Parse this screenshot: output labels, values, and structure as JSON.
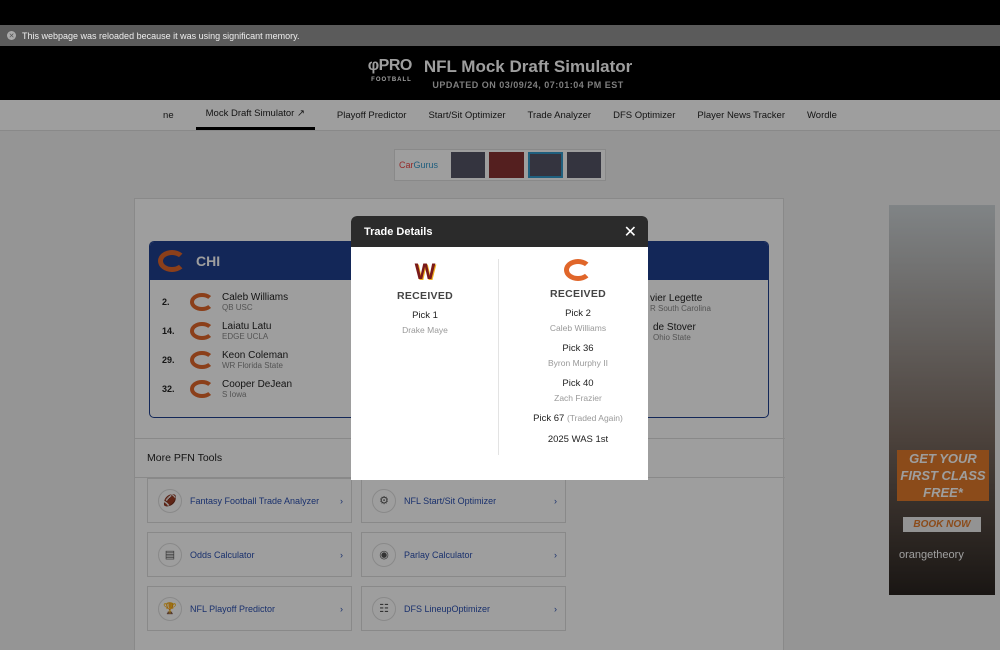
{
  "notice": "This webpage was reloaded because it was using significant memory.",
  "header": {
    "logo": "PRO",
    "logo_sub": "FOOTBALL",
    "title": "NFL Mock Draft Simulator",
    "updated": "UPDATED ON 03/09/24, 07:01:04 PM EST"
  },
  "nav": [
    "ne",
    "Mock Draft Simulator ↗",
    "Playoff Predictor",
    "Start/Sit Optimizer",
    "Trade Analyzer",
    "DFS Optimizer",
    "Player News Tracker",
    "Wordle"
  ],
  "ad_top": {
    "brand": "Car",
    "brand2": "Gurus"
  },
  "team": {
    "abbr": "CHI",
    "picks": [
      {
        "num": "2.",
        "name": "Caleb Williams",
        "pos": "QB USC"
      },
      {
        "num": "14.",
        "name": "Laiatu Latu",
        "pos": "EDGE UCLA"
      },
      {
        "num": "29.",
        "name": "Keon Coleman",
        "pos": "WR Florida State"
      },
      {
        "num": "32.",
        "name": "Cooper DeJean",
        "pos": "S Iowa"
      }
    ],
    "right_picks": [
      {
        "name": "vier Legette",
        "pos": "R South Carolina"
      },
      {
        "name": "de Stover",
        "pos": "Ohio State"
      }
    ]
  },
  "tools": {
    "title": "More PFN Tools",
    "items": [
      {
        "label": "Fantasy Football Trade Analyzer",
        "icon": "football-icon"
      },
      {
        "label": "NFL Start/Sit Optimizer",
        "icon": "gear-icon"
      },
      {
        "label": "Odds Calculator",
        "icon": "calculator-icon"
      },
      {
        "label": "Parlay Calculator",
        "icon": "chip-icon"
      },
      {
        "label": "NFL Playoff Predictor",
        "icon": "trophy-icon"
      },
      {
        "label": "DFS LineupOptimizer",
        "icon": "team-icon"
      }
    ]
  },
  "side_ad": {
    "cta": "GET YOUR FIRST CLASS FREE*",
    "button": "BOOK NOW",
    "brand": "orangetheory"
  },
  "modal": {
    "title": "Trade Details",
    "left": {
      "team": "WAS",
      "received": "RECEIVED",
      "items": [
        {
          "pick": "Pick 1",
          "player": "Drake Maye"
        }
      ]
    },
    "right": {
      "team": "CHI",
      "received": "RECEIVED",
      "items": [
        {
          "pick": "Pick 2",
          "player": "Caleb Williams"
        },
        {
          "pick": "Pick 36",
          "player": "Byron Murphy II"
        },
        {
          "pick": "Pick 40",
          "player": "Zach Frazier"
        }
      ],
      "pick67": "Pick 67",
      "traded_again": "(Traded Again)",
      "future": "2025 WAS 1st"
    }
  },
  "colors": {
    "bears_orange": "#e0662a",
    "bears_navy": "#1f3f8f",
    "commanders": "#7a1a1a",
    "link": "#2a4fb0"
  }
}
